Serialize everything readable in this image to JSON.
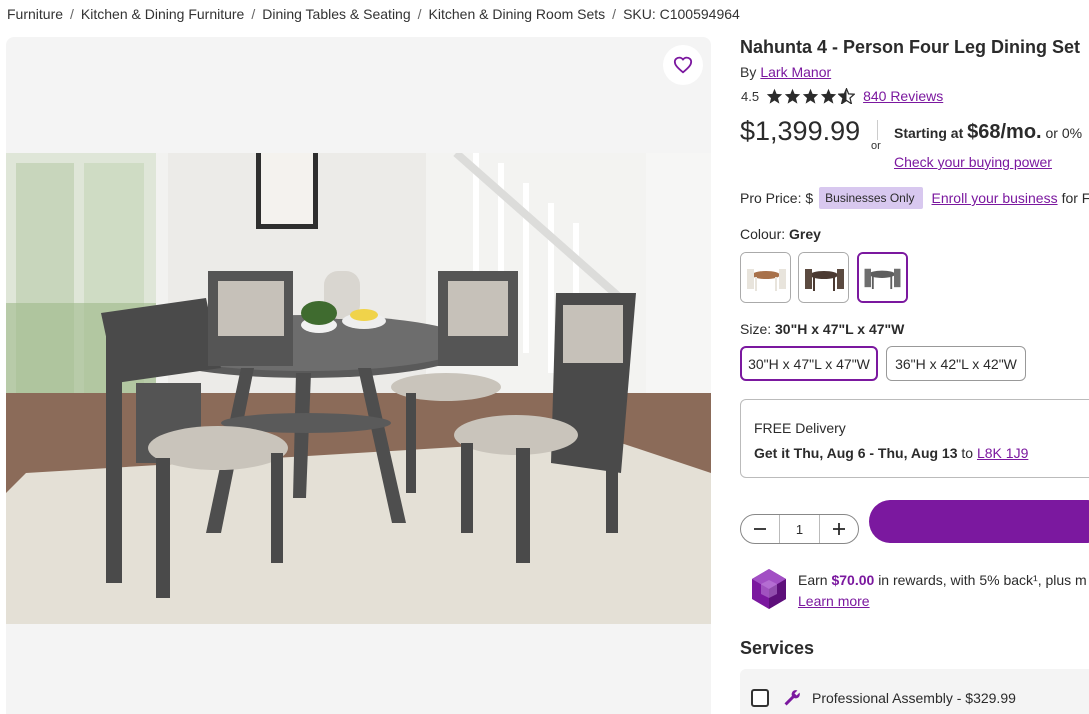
{
  "breadcrumb": {
    "items": [
      "Furniture",
      "Kitchen & Dining Furniture",
      "Dining Tables & Seating",
      "Kitchen & Dining Room Sets"
    ],
    "separator": "/",
    "sku": "SKU: C100594964"
  },
  "product": {
    "title": "Nahunta 4 - Person Four Leg Dining Set",
    "by_label": "By",
    "brand": "Lark Manor",
    "rating": "4.5",
    "rating_value": 4.5,
    "reviews": "840 Reviews",
    "price": "$1,399.99",
    "or_label": "or",
    "financing": {
      "prefix": "Starting at",
      "amount": "$68/mo.",
      "suffix": "or 0%",
      "link": "Check your buying power"
    },
    "pro_price": {
      "label": "Pro Price: $",
      "badge": "Businesses Only",
      "link": "Enroll your business",
      "tail": "for F"
    },
    "colour": {
      "label": "Colour:",
      "selected": "Grey"
    },
    "size": {
      "label": "Size:",
      "selected": "30\"H x 47\"L x 47\"W",
      "options": [
        "30\"H x 47\"L x 47\"W",
        "36\"H x 42\"L x 42\"W"
      ]
    },
    "delivery": {
      "title": "FREE Delivery",
      "date": "Get it Thu, Aug 6 - Thu, Aug 13",
      "to": "to",
      "postal": "L8K 1J9"
    },
    "quantity": "1",
    "rewards": {
      "prefix": "Earn",
      "amount": "$70.00",
      "suffix": "in rewards, with 5% back¹, plus m",
      "link": "Learn more"
    }
  },
  "services": {
    "title": "Services",
    "items": [
      {
        "label": "Professional Assembly - $329.99"
      }
    ]
  },
  "colors": {
    "accent": "#7b189f",
    "badge": "#d8c8ef"
  },
  "icons": [
    "heart-icon",
    "star-icon",
    "minus-icon",
    "plus-icon",
    "gem-icon",
    "wrench-icon"
  ]
}
